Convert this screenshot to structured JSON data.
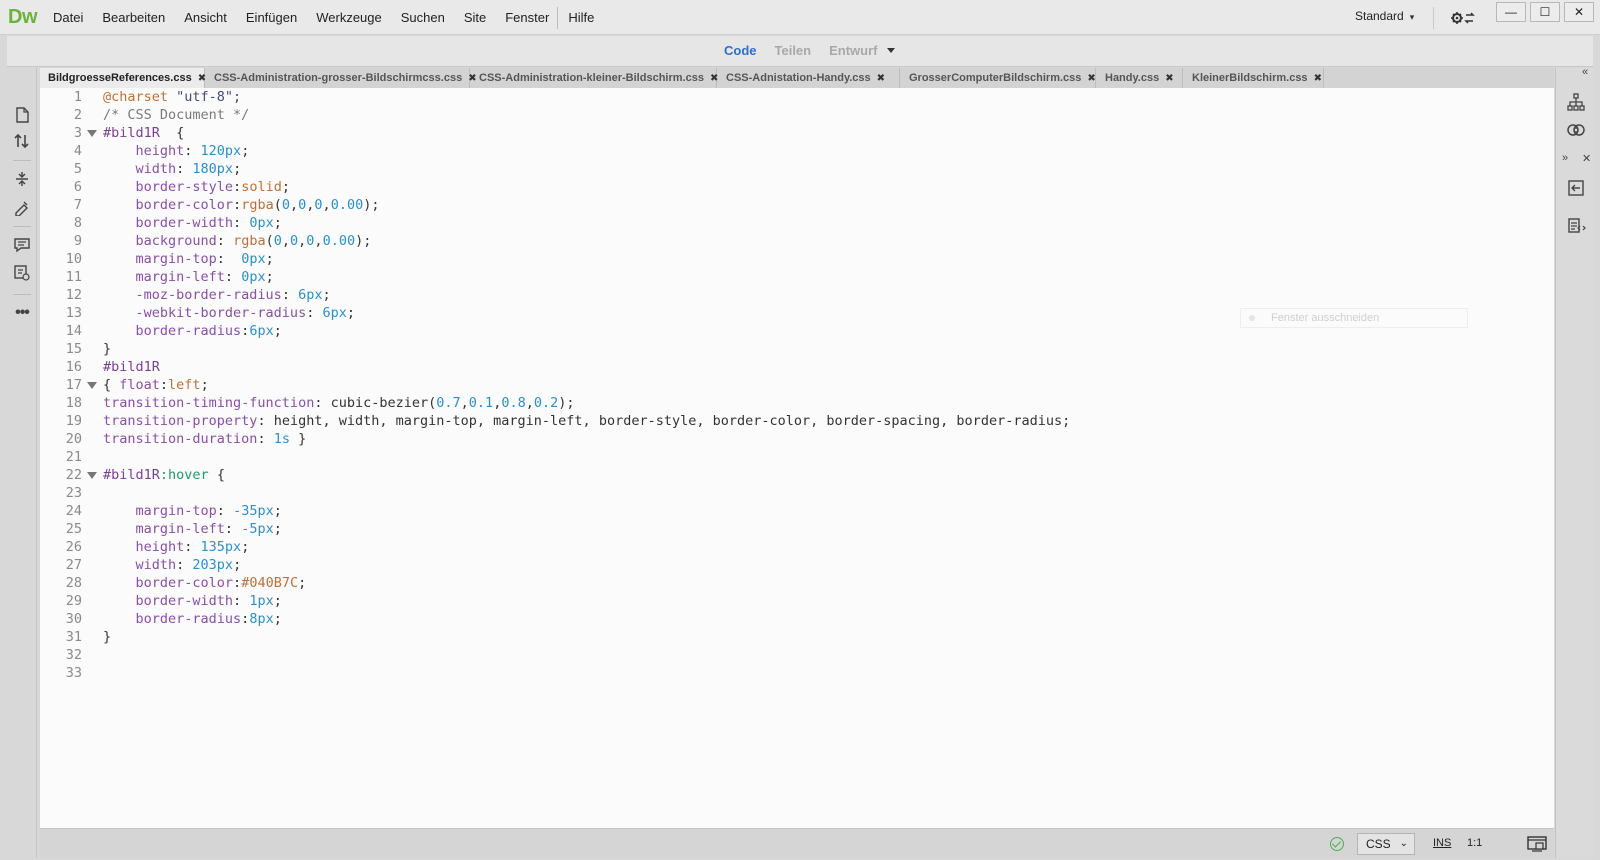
{
  "app": {
    "logo": "Dw",
    "menu": [
      "Datei",
      "Bearbeiten",
      "Ansicht",
      "Einfügen",
      "Werkzeuge",
      "Suchen",
      "Site",
      "Fenster",
      "Hilfe"
    ],
    "workspace": "Standard",
    "window_buttons": [
      "—",
      "☐",
      "✕"
    ]
  },
  "view_switcher": {
    "tabs": [
      "Code",
      "Teilen",
      "Entwurf"
    ],
    "active": "Code"
  },
  "document_tabs": [
    {
      "label": "BildgroesseReferences.css",
      "active": true
    },
    {
      "label": "CSS-Administration-grosser-Bildschirmcss.css",
      "active": false
    },
    {
      "label": "CSS-Administration-kleiner-Bildschirm.css",
      "active": false
    },
    {
      "label": "CSS-Adnistation-Handy.css",
      "active": false
    },
    {
      "label": "GrosserComputerBildschirm.css",
      "active": false
    },
    {
      "label": "Handy.css",
      "active": false
    },
    {
      "label": "KleinerBildschirm.css",
      "active": false
    }
  ],
  "code_lines": [
    "1",
    "2",
    "3",
    "4",
    "5",
    "6",
    "7",
    "8",
    "9",
    "10",
    "11",
    "12",
    "13",
    "14",
    "15",
    "16",
    "17",
    "18",
    "19",
    "20",
    "21",
    "22",
    "23",
    "24",
    "25",
    "26",
    "27",
    "28",
    "29",
    "30",
    "31",
    "32",
    "33"
  ],
  "code": {
    "l1_at": "@charset",
    "l1_str": " \"utf-8\";",
    "l2": "/* CSS Document */",
    "l3_sel": "#bild1R",
    "l3_rest": "  {",
    "l4_p": "    height",
    "l4_v": " 120px",
    "l5_p": "    width",
    "l5_v": " 180px",
    "l6_p": "    border-style",
    "l6_v": "solid",
    "l7_p": "    border-color",
    "l7_f": "rgba",
    "l7_args": [
      "0",
      "0",
      "0",
      "0.00"
    ],
    "l8_p": "    border-width",
    "l8_v": " 0px",
    "l9_p": "    background",
    "l9_f": " rgba",
    "l9_args": [
      "0",
      "0",
      "0",
      "0.00"
    ],
    "l10_p": "    margin-top",
    "l10_v": "  0px",
    "l11_p": "    margin-left",
    "l11_v": " 0px",
    "l12_p": "    -moz-border-radius",
    "l12_v": " 6px",
    "l13_p": "    -webkit-border-radius",
    "l13_v": " 6px",
    "l14_p": "    border-radius",
    "l14_v": "6px",
    "l15": "}",
    "l16_sel": "#bild1R",
    "l17_a": "{ ",
    "l17_p": "float",
    "l17_v": "left",
    "l18_p": "transition-timing-function",
    "l18_f": " cubic-bezier(",
    "l18_args": [
      "0.7",
      "0.1",
      "0.8",
      "0.2"
    ],
    "l19_p": "transition-property",
    "l19_v": " height, width, margin-top, margin-left, border-style, border-color, border-spacing, border-radius;",
    "l20_p": "transition-duration",
    "l20_v": " 1s",
    "l20_end": " }",
    "l22_sel": "#bild1R",
    "l22_pseudo": ":hover",
    "l22_end": " {",
    "l24_p": "    margin-top",
    "l24_v": " -35px",
    "l25_p": "    margin-left",
    "l25_v": " -5px",
    "l26_p": "    height",
    "l26_v": " 135px",
    "l27_p": "    width",
    "l27_v": " 203px",
    "l28_p": "    border-color",
    "l28_v": "#040B7C",
    "l29_p": "    border-width",
    "l29_v": " 1px",
    "l30_p": "    border-radius",
    "l30_v": "8px",
    "l31": "}"
  },
  "tooltip": "Fenster ausschneiden",
  "status": {
    "language": "CSS",
    "mode": "INS",
    "position": "1:1"
  },
  "colors": {
    "logo": "#6bb33c",
    "active_view": "#2f6fc9",
    "property": "#8a4fa8",
    "number": "#2a8fcf",
    "keyword": "#c07033"
  }
}
